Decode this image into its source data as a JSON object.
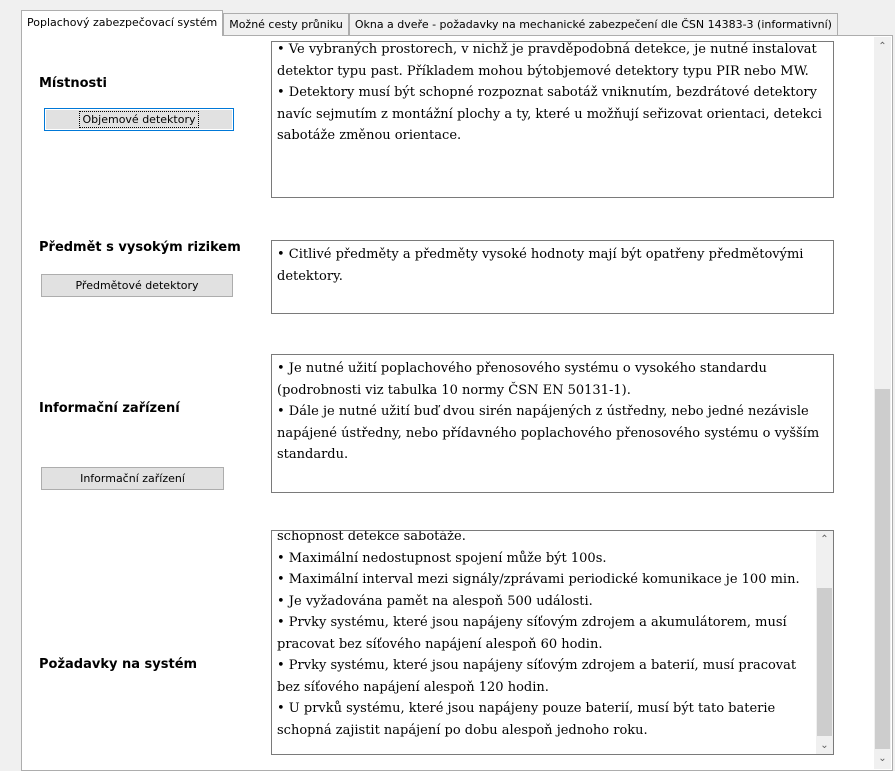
{
  "tabs": [
    {
      "label": "Poplachový zabezpečovací systém",
      "active": true
    },
    {
      "label": "Možné cesty průniku",
      "active": false
    },
    {
      "label": "Okna a dveře - požadavky na mechanické zabezpečení dle ČSN 14383-3 (informativní)",
      "active": false
    }
  ],
  "sections": {
    "rooms": {
      "label": "Místnosti",
      "button": "Objemové detektory",
      "lines": [
        "• Ve vybraných prostorech, v nichž je pravděpodobná detekce, je nutné instalovat detektor typu past. Příkladem mohou býtobjemové detektory typu PIR nebo MW.",
        "• Detektory musí být schopné rozpoznat sabotáž vniknutím, bezdrátové detektory navíc sejmutím z montážní plochy a ty, které u možňují seřizovat orientaci, detekci sabotáže změnou orientace."
      ]
    },
    "high_risk": {
      "label": "Předmět s vysokým rizikem",
      "button": "Předmětové detektory",
      "lines": [
        "• Citlivé předměty a předměty vysoké hodnoty mají být opatřeny předmětovými detektory."
      ]
    },
    "info": {
      "label": "Informační zařízení",
      "button": "Informační zařízení",
      "lines": [
        "• Je nutné užití poplachového přenosového systému o vysokého standardu (podrobnosti viz tabulka 10 normy ČSN EN 50131-1).",
        "• Dále je nutné užití buď dvou sirén napájených z ústředny, nebo jedné nezávisle napájené ústředny, nebo přídavného poplachového přenosového systému o vyšším standardu."
      ]
    },
    "system": {
      "label": "Požadavky na systém",
      "lines": [
        "schopnost detekce sabotáže.",
        "• Maximální nedostupnost spojení může být 100s.",
        "• Maximální interval mezi signály/zprávami periodické komunikace je 100 min.",
        "• Je vyžadována pamět na alespoň 500 události.",
        "• Prvky systému, které jsou napájeny síťovým zdrojem a akumulátorem, musí pracovat bez síťového napájení alespoň 60 hodin.",
        "• Prvky systému, které jsou napájeny síťovým zdrojem a baterií, musí pracovat bez síťového napájení alespoň 120 hodin.",
        "• U prvků systému, které jsou napájeny pouze baterií, musí být tato baterie schopná zajistit napájení po dobu alespoň jednoho roku."
      ]
    }
  },
  "icons": {
    "scroll_up": "chevron-up-icon",
    "scroll_down": "chevron-down-icon"
  },
  "colors": {
    "focus_border": "#0078d7",
    "button_bg": "#e1e1e1",
    "scroll_thumb": "#cdcdcd"
  }
}
